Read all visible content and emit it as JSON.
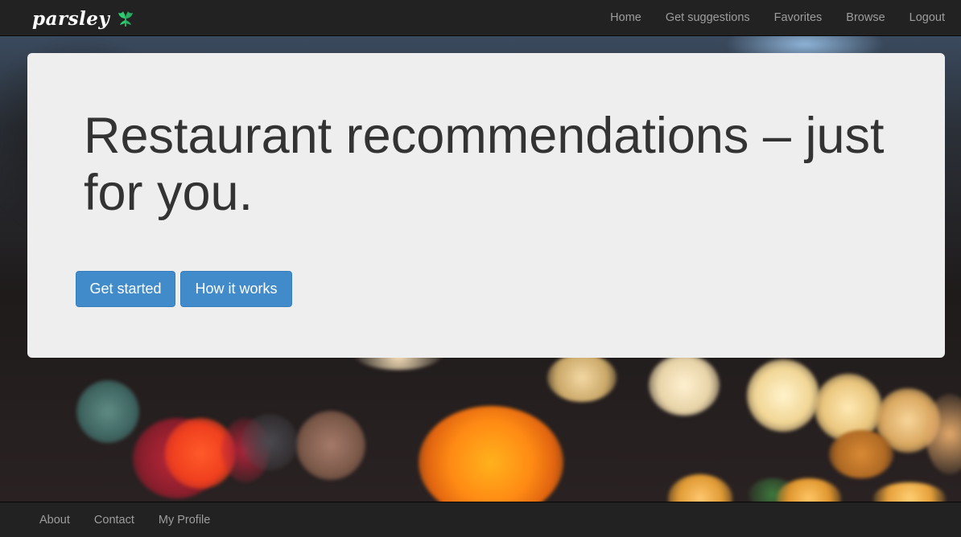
{
  "navbar": {
    "brand": "parsley",
    "brand_icon": "parsley-leaf-icon",
    "links": [
      "Home",
      "Get suggestions",
      "Favorites",
      "Browse",
      "Logout"
    ]
  },
  "hero": {
    "headline": "Restaurant recommendations – just for you.",
    "buttons": {
      "get_started": "Get started",
      "how_it_works": "How it works"
    }
  },
  "footer": {
    "links": [
      "About",
      "Contact",
      "My Profile"
    ]
  },
  "colors": {
    "primary_button": "#428bca",
    "navbar": "#222222",
    "jumbotron": "#eeeeee",
    "leaf_green": "#2ecc71"
  }
}
